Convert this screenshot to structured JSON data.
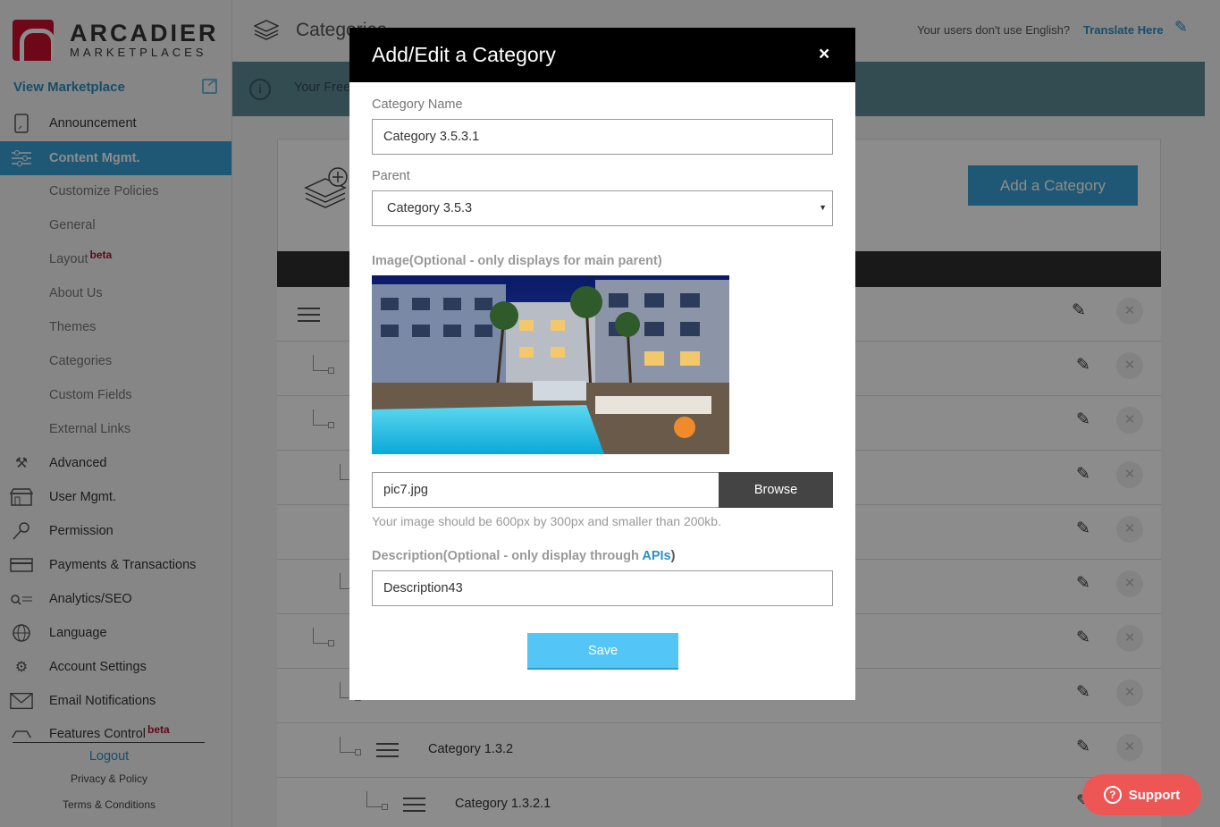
{
  "brand": {
    "line1": "ARCADIER",
    "line2": "MARKETPLACES",
    "red": "#c8102e"
  },
  "sidebar": {
    "view_marketplace": "View Marketplace",
    "items": [
      {
        "label": "Announcement",
        "icon": "tablet-icon"
      },
      {
        "label": "Content Mgmt.",
        "icon": "sliders-icon",
        "active": true
      },
      {
        "label": "Advanced",
        "icon": "tools-icon"
      },
      {
        "label": "User Mgmt.",
        "icon": "store-icon"
      },
      {
        "label": "Permission",
        "icon": "key-icon"
      },
      {
        "label": "Payments & Transactions",
        "icon": "card-icon"
      },
      {
        "label": "Analytics/SEO",
        "icon": "analytics-icon"
      },
      {
        "label": "Language",
        "icon": "globe-icon"
      },
      {
        "label": "Account Settings",
        "icon": "gear-people-icon"
      },
      {
        "label": "Email Notifications",
        "icon": "envelope-icon"
      },
      {
        "label": "Features Control",
        "icon": "feature-icon",
        "badge": "beta"
      }
    ],
    "subitems": [
      "Customize Policies",
      "General",
      "Layout",
      "About Us",
      "Themes",
      "Categories",
      "Custom Fields",
      "External Links"
    ],
    "layout_badge": "beta",
    "logout": "Logout",
    "privacy": "Privacy & Policy",
    "terms": "Terms & Conditions"
  },
  "header": {
    "title": "Categories",
    "translate_question": "Your users don't use English?",
    "translate_link": "Translate Here"
  },
  "infobar": {
    "text": "Your Free"
  },
  "main": {
    "add_button": "Add a Category",
    "rows": [
      {
        "label": ""
      },
      {
        "label": ""
      },
      {
        "label": ""
      },
      {
        "label": ""
      },
      {
        "label": ""
      },
      {
        "label": ""
      },
      {
        "label": ""
      },
      {
        "label": ""
      },
      {
        "label": "Category 1.3.2"
      },
      {
        "label": "Category 1.3.2.1"
      }
    ]
  },
  "modal": {
    "title": "Add/Edit a Category",
    "close": "×",
    "name_label": "Category Name",
    "name_value": "Category 3.5.3.1",
    "parent_label": "Parent",
    "parent_value": "Category 3.5.3",
    "image_label": "Image(Optional - only displays for main parent)",
    "file_value": "pic7.jpg",
    "browse": "Browse",
    "hint": "Your image should be 600px by 300px and smaller than 200kb.",
    "desc_label_prefix": "Description(Optional - only display through ",
    "desc_label_link": "APIs",
    "desc_label_suffix": ")",
    "desc_value": "Description43",
    "save": "Save"
  },
  "support": {
    "label": "Support"
  },
  "colors": {
    "accent": "#3aa0d4",
    "save": "#54c6f6",
    "support": "#ee5656"
  }
}
